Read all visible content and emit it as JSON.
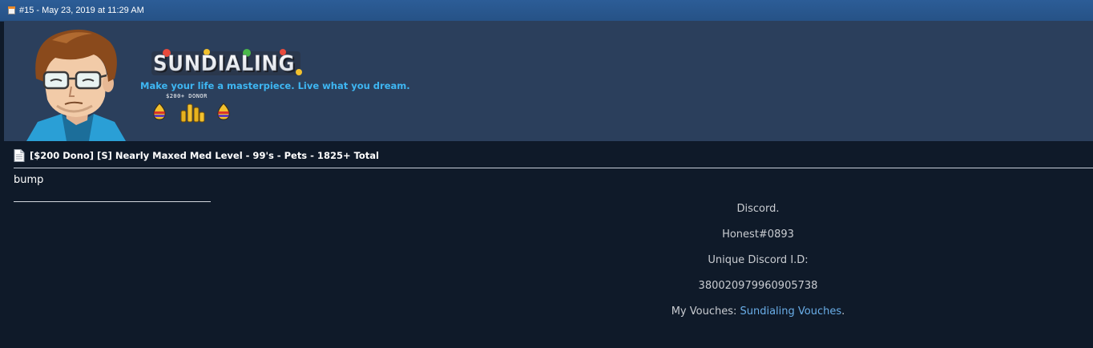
{
  "post": {
    "meta": "#15 - May 23, 2019 at 11:29 AM"
  },
  "profile": {
    "username": "SUNDIALING",
    "usertitle": "Make your life a masterpiece. Live what you dream.",
    "donor_label": "$200+ DONOR",
    "badges": [
      "egg-badge",
      "gold-coins-badge",
      "egg-badge"
    ]
  },
  "thread": {
    "title": "[$200 Dono] [S] Nearly Maxed Med Level - 99's - Pets - 1825+ Total"
  },
  "message": {
    "body": "bump"
  },
  "signature": {
    "line1": "Discord.",
    "line2": "Honest#0893",
    "line3": "Unique Discord I.D:",
    "line4": "380020979960905738",
    "vouches_prefix": "My Vouches: ",
    "vouches_link": "Sundialing Vouches",
    "vouches_suffix": "."
  },
  "colors": {
    "topbar": "#2c5d97",
    "profile_band": "#2b3f5c",
    "body_bg": "#0f1a29",
    "usertitle": "#3eb6f2",
    "link": "#6aaee8"
  }
}
